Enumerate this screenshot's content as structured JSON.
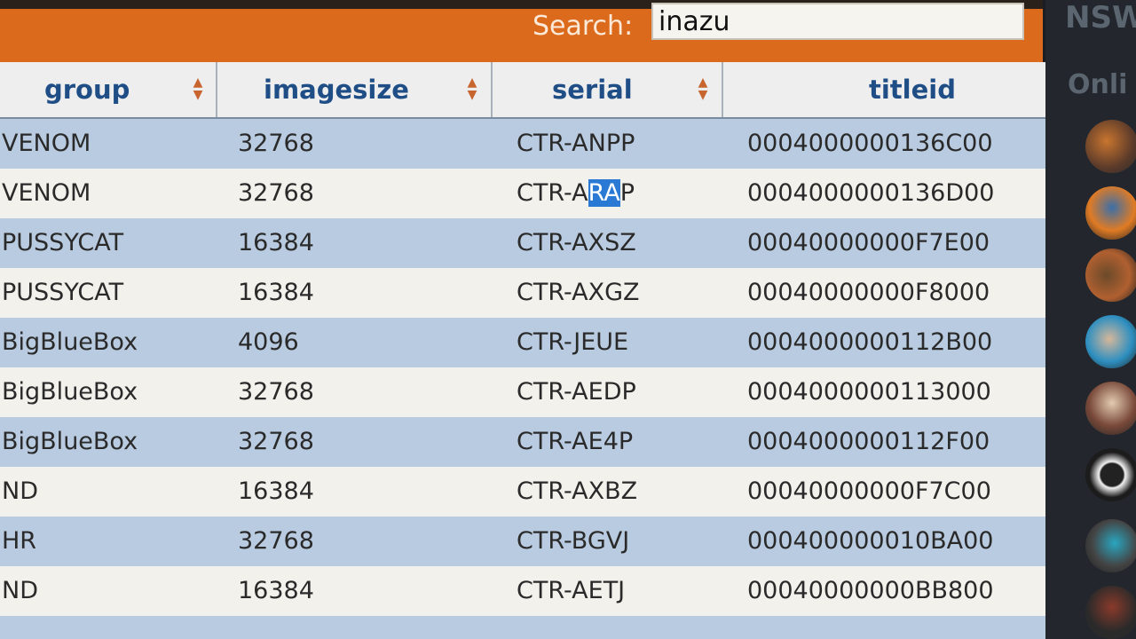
{
  "search": {
    "label": "Search:",
    "value": "inazu"
  },
  "columns": [
    {
      "label": "group",
      "sortable": true
    },
    {
      "label": "imagesize",
      "sortable": true
    },
    {
      "label": "serial",
      "sortable": true
    },
    {
      "label": "titleid",
      "sortable": false
    }
  ],
  "rows": [
    {
      "group": "VENOM",
      "imagesize": "32768",
      "serial": "CTR-ANPP",
      "titleid": "0004000000136C00"
    },
    {
      "group": "VENOM",
      "imagesize": "32768",
      "serial_pre": "CTR-A",
      "serial_hl": "RA",
      "serial_post": "P",
      "titleid": "0004000000136D00"
    },
    {
      "group": "PUSSYCAT",
      "imagesize": "16384",
      "serial": "CTR-AXSZ",
      "titleid": "00040000000F7E00"
    },
    {
      "group": "PUSSYCAT",
      "imagesize": "16384",
      "serial": "CTR-AXGZ",
      "titleid": "00040000000F8000"
    },
    {
      "group": "BigBlueBox",
      "imagesize": "4096",
      "serial": "CTR-JEUE",
      "titleid": "0004000000112B00"
    },
    {
      "group": "BigBlueBox",
      "imagesize": "32768",
      "serial": "CTR-AEDP",
      "titleid": "0004000000113000"
    },
    {
      "group": "BigBlueBox",
      "imagesize": "32768",
      "serial": "CTR-AE4P",
      "titleid": "0004000000112F00"
    },
    {
      "group": "ND",
      "imagesize": "16384",
      "serial": "CTR-AXBZ",
      "titleid": "00040000000F7C00"
    },
    {
      "group": "HR",
      "imagesize": "32768",
      "serial": "CTR-BGVJ",
      "titleid": "000400000010BA00"
    },
    {
      "group": "ND",
      "imagesize": "16384",
      "serial": "CTR-AETJ",
      "titleid": "00040000000BB800"
    }
  ],
  "side_panel": {
    "title": "NSW",
    "subtitle": "Onli"
  },
  "colors": {
    "accent": "#dc6a1c",
    "header_text": "#1f4e86",
    "row_alt": "#b9cbe0",
    "selection": "#2a79d4"
  }
}
